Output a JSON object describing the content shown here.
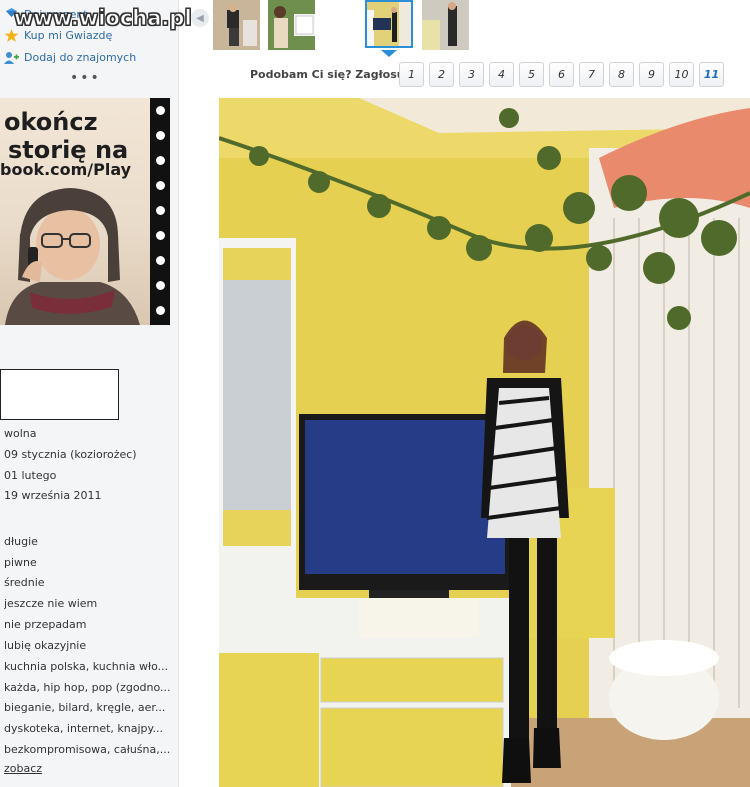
{
  "sidebar": {
    "watermark": "www.wiocha.pl",
    "links": [
      {
        "label": "Daj prezent",
        "icon": "gift-icon"
      },
      {
        "label": "Kup mi Gwiazdę",
        "icon": "star-icon"
      },
      {
        "label": "Dodaj do znajomych",
        "icon": "add-friend-icon"
      }
    ],
    "more": "•••",
    "ad": {
      "line1": "okończ",
      "line2": "storię na",
      "line3": "book.com/Play"
    },
    "info": [
      "wolna",
      "09 stycznia (koziorożec)",
      "01 lutego",
      "19 września 2011",
      "długie",
      "piwne",
      "średnie",
      "jeszcze nie wiem",
      "nie przepadam",
      "lubię okazyjnie",
      "kuchnia polska, kuchnia wło...",
      "każda, hip hop, pop (zgodno...",
      "bieganie, bilard, kręgle, aer...",
      "dyskoteka, internet, knajpy...",
      "bezkompromisowa, całuśna,..."
    ],
    "see_link": "zobacz"
  },
  "gallery": {
    "scroll_left_icon": "chevron-left-icon",
    "thumbnails": [
      "photo-1",
      "photo-2",
      "photo-3",
      "photo-4"
    ],
    "selected_index": 2
  },
  "vote": {
    "label": "Podobam Ci się? Zagłosuj:",
    "options": [
      "1",
      "2",
      "3",
      "4",
      "5",
      "6",
      "7",
      "8",
      "9",
      "10",
      "11"
    ],
    "highlighted": "11"
  },
  "colors": {
    "link": "#2d6aa8",
    "selected_border": "#2b8ed6",
    "wall": "#e9d45a",
    "sidebar_bg": "#f4f5f7"
  }
}
